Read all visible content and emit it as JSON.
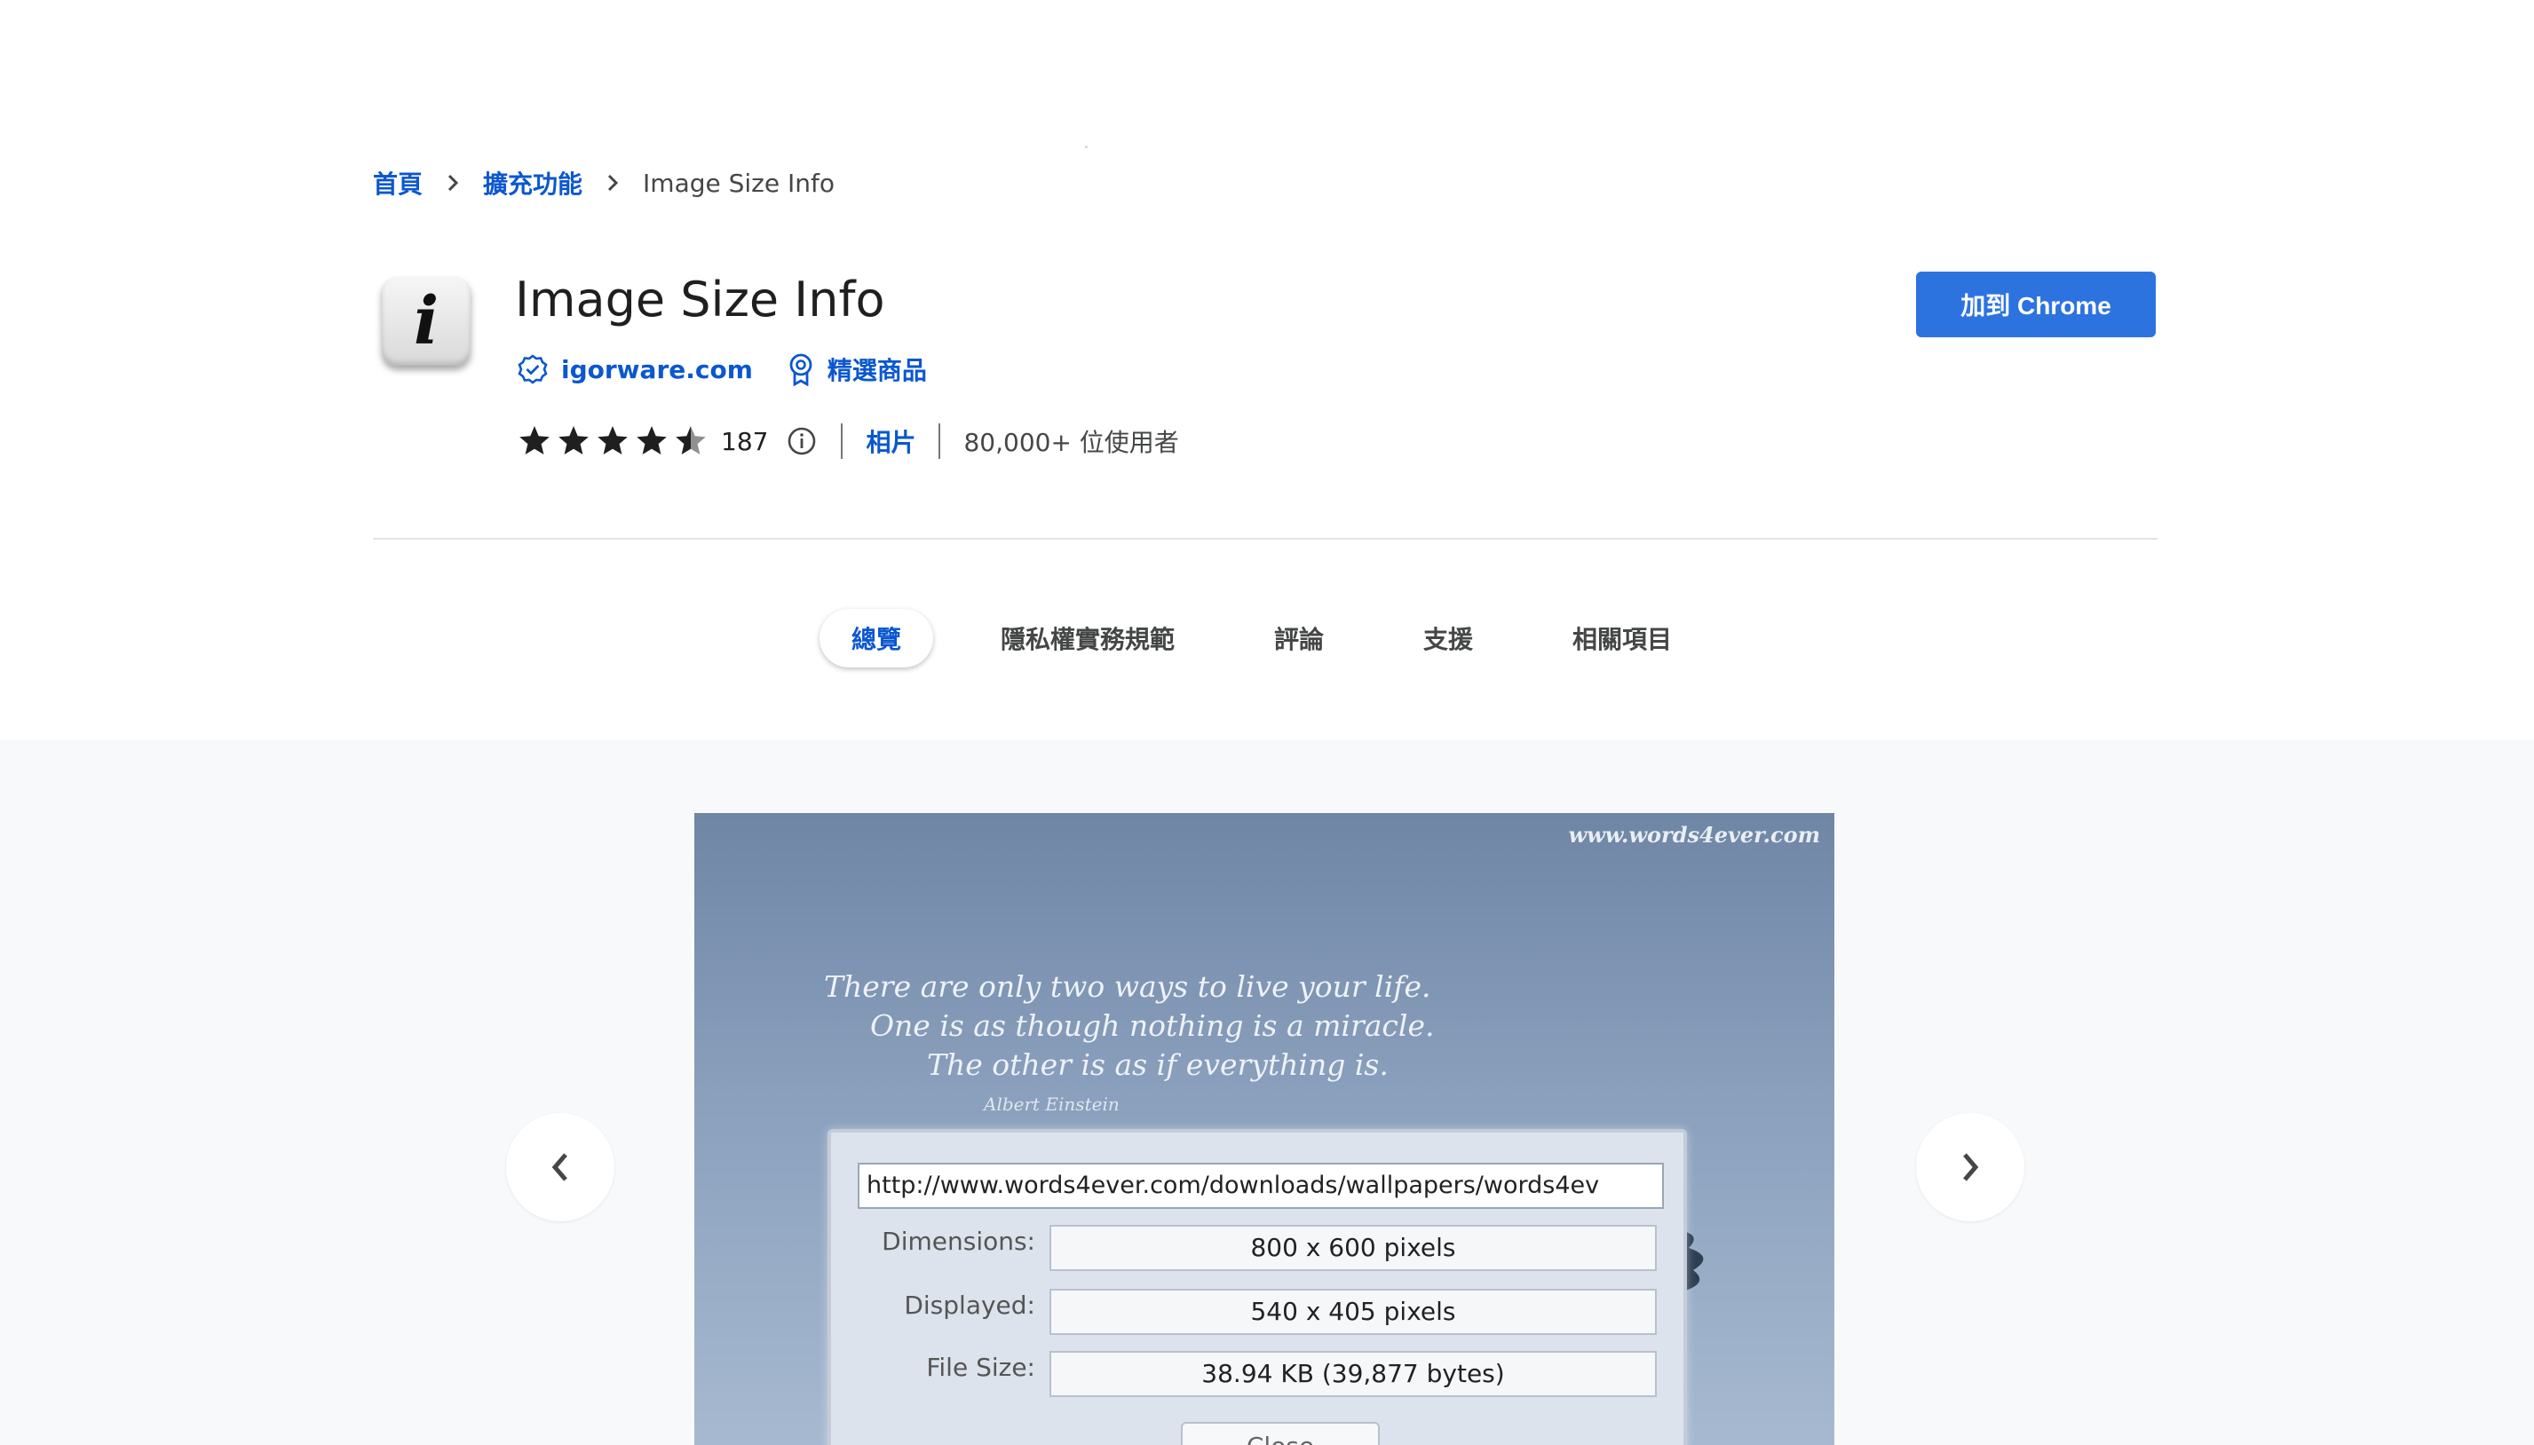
{
  "breadcrumb": {
    "home": "首頁",
    "extensions": "擴充功能",
    "current": "Image Size Info"
  },
  "extension": {
    "icon_glyph": "i",
    "name": "Image Size Info",
    "publisher": "igorware.com",
    "featured": "精選商品",
    "rating": 4.5,
    "rating_count": "187",
    "category": "相片",
    "users": "80,000+ 位使用者",
    "add_button": "加到 Chrome"
  },
  "tabs": [
    {
      "label": "總覽",
      "active": true
    },
    {
      "label": "隱私權實務規範",
      "active": false
    },
    {
      "label": "評論",
      "active": false
    },
    {
      "label": "支援",
      "active": false
    },
    {
      "label": "相關項目",
      "active": false
    }
  ],
  "screenshot": {
    "watermark": "www.words4ever.com",
    "quote_lines": [
      "There are only two ways to live your life.",
      "One is as though nothing is a miracle.",
      "The other is as if everything is."
    ],
    "author": "Albert Einstein",
    "url": "http://www.words4ever.com/downloads/wallpapers/words4ev",
    "dimensions_label": "Dimensions:",
    "dimensions_value": "800 x 600 pixels",
    "displayed_label": "Displayed:",
    "displayed_value": "540 x 405 pixels",
    "filesize_label": "File Size:",
    "filesize_value": "38.94 KB (39,877 bytes)",
    "close_label": "Close"
  },
  "icons": [
    "chevron-right-icon",
    "verified-icon",
    "award-icon",
    "star-icon",
    "info-icon",
    "chevron-left-icon"
  ],
  "colors": {
    "accent": "#0b57d0",
    "button": "#2d73e0"
  }
}
